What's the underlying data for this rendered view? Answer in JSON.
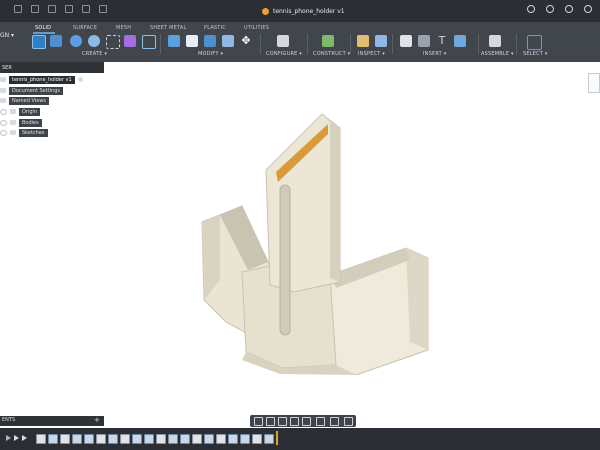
{
  "window": {
    "title": "tennis_phone_holder v1"
  },
  "mode_button": "GN",
  "workspace_tabs": [
    {
      "label": "SOLID",
      "active": true
    },
    {
      "label": "SURFACE",
      "active": false
    },
    {
      "label": "MESH",
      "active": false
    },
    {
      "label": "SHEET METAL",
      "active": false
    },
    {
      "label": "PLASTIC",
      "active": false
    },
    {
      "label": "UTILITIES",
      "active": false
    }
  ],
  "tool_groups": [
    {
      "label": "CREATE ▾"
    },
    {
      "label": "MODIFY ▾"
    },
    {
      "label": "CONFIGURE ▾"
    },
    {
      "label": "CONSTRUCT ▾"
    },
    {
      "label": "INSPECT ▾"
    },
    {
      "label": "INSERT ▾"
    },
    {
      "label": "ASSEMBLE ▾"
    },
    {
      "label": "SELECT ▾"
    }
  ],
  "browser": {
    "header": "SER",
    "root": "tennis_phone_holder v1",
    "items": [
      {
        "label": "Document Settings"
      },
      {
        "label": "Named Views"
      },
      {
        "label": "Origin"
      },
      {
        "label": "Bodies"
      },
      {
        "label": "Sketches"
      }
    ]
  },
  "comments_label": "ENTS",
  "comments_add": "+",
  "colors": {
    "accent_blue": "#3d8fd6",
    "toolbar_bg": "#41464c",
    "titlebar_bg": "#2b2f35",
    "model_body": "#ebe6d7",
    "model_shadow": "#b8b2a2",
    "tape_orange": "#d99a3a"
  }
}
